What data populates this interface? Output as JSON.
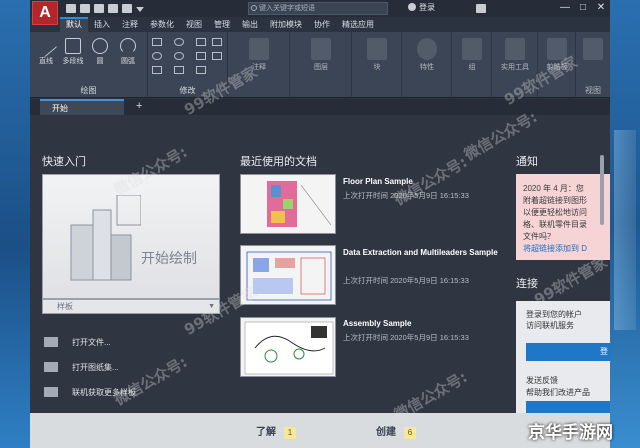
{
  "app": {
    "logo_letter": "A",
    "search_placeholder": "键入关键字或短语",
    "login_label": "登录",
    "window_buttons": [
      "—",
      "□",
      "✕"
    ]
  },
  "ribbon_tabs": [
    "默认",
    "插入",
    "注释",
    "参数化",
    "视图",
    "管理",
    "输出",
    "附加模块",
    "协作",
    "精选应用"
  ],
  "ribbon": {
    "draw_tools": [
      "直线",
      "多段线",
      "圆",
      "圆弧"
    ],
    "draw_group_label": "绘图",
    "modify_group_label": "修改",
    "more_groups": [
      {
        "label": "注释"
      },
      {
        "label": "图层"
      },
      {
        "label": "块"
      },
      {
        "label": "特性"
      },
      {
        "label": "组"
      },
      {
        "label": "实用工具"
      },
      {
        "label": "剪贴板"
      }
    ],
    "view_group_label": "视图"
  },
  "doc_tab": {
    "label": "开始",
    "plus": "+"
  },
  "start_page": {
    "quick_start": {
      "title": "快速入门",
      "template_text": "开始绘制",
      "template_select": "样板",
      "items": [
        "打开文件...",
        "打开图纸集...",
        "联机获取更多样板"
      ]
    },
    "recent": {
      "title": "最近使用的文档",
      "docs": [
        {
          "title": "Floor Plan Sample",
          "meta": "上次打开时间 2020年5月9日 16:15:33"
        },
        {
          "title": "Data Extraction and Multileaders Sample",
          "meta": "上次打开时间 2020年5月9日 16:15:33"
        },
        {
          "title": "Assembly Sample",
          "meta": "上次打开时间 2020年5月9日 16:15:33"
        }
      ]
    },
    "notify": {
      "title": "通知",
      "lines": [
        "2020 年 4 月：您",
        "附着超链接到图形",
        "以便更轻松地访问",
        "格、联机零件目录",
        "文件吗？"
      ],
      "link": "将超链接添加到 D"
    },
    "connect": {
      "title": "连接",
      "login_line1": "登录到您的帐户",
      "login_line2": "访问联机服务",
      "login_btn": "登",
      "feedback_title": "发送反馈",
      "feedback_text": "帮助我们改进产品"
    },
    "bottom_tabs": [
      {
        "label": "了解",
        "badge": "1"
      },
      {
        "label": "创建",
        "badge": "6"
      }
    ]
  },
  "watermarks": [
    "99软件管家",
    "微信公众号:",
    "微信公众号:",
    "99软件管家",
    "微信公众号:",
    "微信公众号:",
    "99软件管家",
    "微信公众号:",
    "99软件管家"
  ],
  "brand": "京华手游网",
  "colors": {
    "accent": "#1f77c8",
    "logo_red": "#b3262a"
  }
}
